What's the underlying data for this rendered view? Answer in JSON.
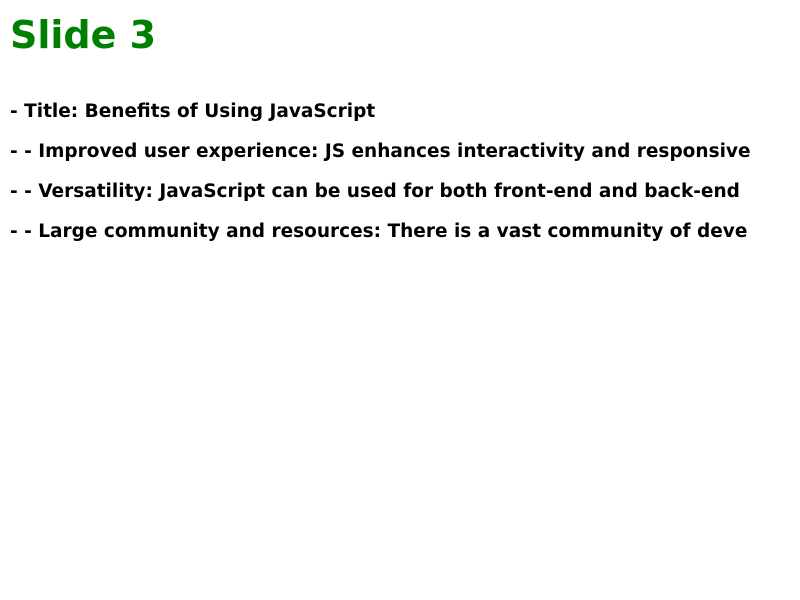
{
  "slide": {
    "title": "Slide 3",
    "bullets": [
      "- Title: Benefits of Using JavaScript",
      "- - Improved user experience: JS enhances interactivity and responsive",
      "- - Versatility: JavaScript can be used for both front-end and back-end",
      "- - Large community and resources: There is a vast community of deve"
    ]
  },
  "colors": {
    "title": "#008000",
    "text": "#000000",
    "background": "#ffffff"
  }
}
